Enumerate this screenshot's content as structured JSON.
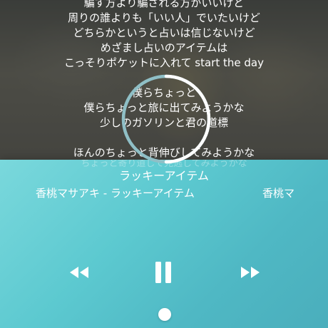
{
  "lyrics": [
    "騙す方より騙される方がいいけど",
    "周りの誰よりも「いい人」でいたいけど",
    "どちらかというと占いは信じないけど",
    "めざまし占いのアイテムは",
    "こっそりポケットに入れて start the day",
    "",
    "僕らちょっと",
    "僕らちょっと旅に出てみようかな",
    "少しのガソリンと君の道標",
    "",
    "ほんのちょっと背伸びしてみようかな"
  ],
  "faded_lyric": "ちょっと寄り道して見逃してみようかな",
  "player": {
    "song_title": "ラッキーアイテム",
    "marquee_primary": "香桃マサアキ - ラッキーアイテム",
    "marquee_secondary": "香桃マ",
    "state": "playing",
    "progress": 0.5
  },
  "icons": {
    "prev": "rewind-icon",
    "pause": "pause-icon",
    "next": "fast-forward-icon"
  },
  "colors": {
    "panel_start": "#7ad8dc",
    "panel_end": "#4aaebc",
    "ring_track": "#8fbfc6",
    "ring_progress": "#ffffff"
  }
}
